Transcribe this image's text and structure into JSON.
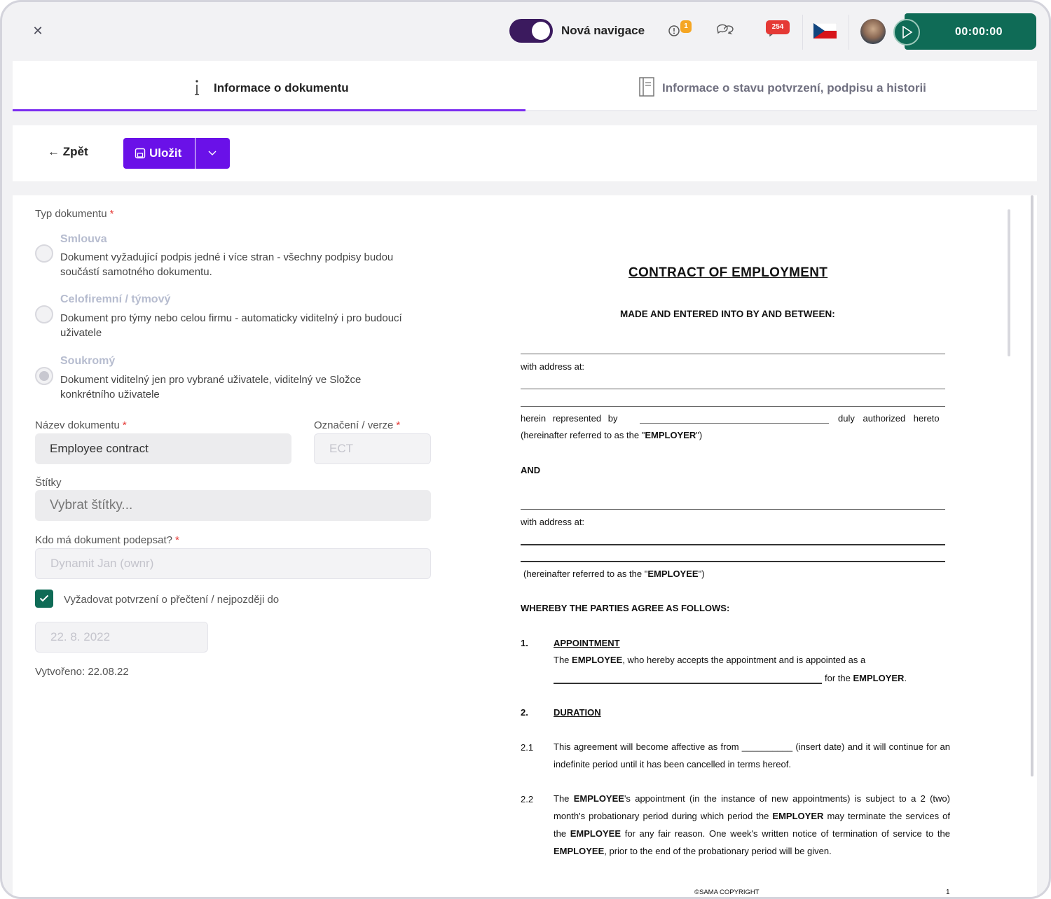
{
  "topbar": {
    "nav_label": "Nová navigace",
    "alert_count": "1",
    "notifications_count": "254",
    "timer": "00:00:00"
  },
  "tabs": [
    {
      "label": "Informace o dokumentu",
      "active": true
    },
    {
      "label": "Informace o stavu potvrzení, podpisu a historii",
      "active": false
    }
  ],
  "actions": {
    "back_label": "Zpět",
    "save_label": "Uložit"
  },
  "form": {
    "doc_type_label": "Typ dokumentu",
    "required_mark": "*",
    "options": [
      {
        "title": "Smlouva",
        "description": "Dokument vyžadující podpis jedné i více stran - všechny podpisy budou součástí samotného dokumentu.",
        "checked": false
      },
      {
        "title": "Celofiremní / týmový",
        "description": "Dokument pro týmy nebo celou firmu - automaticky viditelný i pro budoucí uživatele",
        "checked": false
      },
      {
        "title": "Soukromý",
        "description": "Dokument viditelný jen pro vybrané uživatele, viditelný ve Složce konkrétního uživatele",
        "checked": true
      }
    ],
    "name_label": "Název dokumentu",
    "name_value": "Employee contract",
    "version_label": "Označení / verze",
    "version_value": "ECT",
    "tags_label": "Štítky",
    "tags_placeholder": "Vybrat štítky...",
    "signer_label": "Kdo má dokument podepsat?",
    "signer_value": "Dynamit Jan (ownr)",
    "read_confirm_label": "Vyžadovat potvrzení o přečtení / nejpozději do",
    "read_confirm_checked": true,
    "deadline_value": "22. 8. 2022",
    "created": "Vytvořeno: 22.08.22"
  },
  "document": {
    "title": "CONTRACT OF EMPLOYMENT",
    "subtitle": "MADE AND ENTERED INTO BY AND BETWEEN:",
    "with_address": "with address at:",
    "represented_by": "herein represented by",
    "duly_authorized": "duly authorized hereto",
    "employer_ref_pre": "(hereinafter referred to as the \"",
    "employer": "EMPLOYER",
    "ref_post": "\")",
    "and": "AND",
    "employee_ref_pre": "(hereinafter referred to as the \"",
    "employee": "EMPLOYEE",
    "agree": "WHEREBY THE PARTIES AGREE AS FOLLOWS:",
    "s1_num": "1.",
    "s1_title": "APPOINTMENT",
    "s1_text_a": "The",
    "s1_text_b": ", who hereby accepts the appointment and is appointed as a",
    "s1_text_c": "for the",
    "s2_num": "2.",
    "s2_title": "DURATION",
    "s21_num": "2.1",
    "s21_text": "This agreement will become affective as from __________ (insert date) and it will continue for an indefinite period until it has been cancelled in terms hereof.",
    "s22_num": "2.2",
    "s22_a": "The",
    "s22_b": "'s appointment (in the instance of new appointments) is subject to a 2 (two) month's probationary period during which period the",
    "s22_c": "may terminate the services of the",
    "s22_d": "for any fair reason. One week's written notice of termination of service to the",
    "s22_e": ", prior to the end of the probationary period will be given.",
    "footer": "©SAMA COPYRIGHT",
    "page_number": "1"
  }
}
